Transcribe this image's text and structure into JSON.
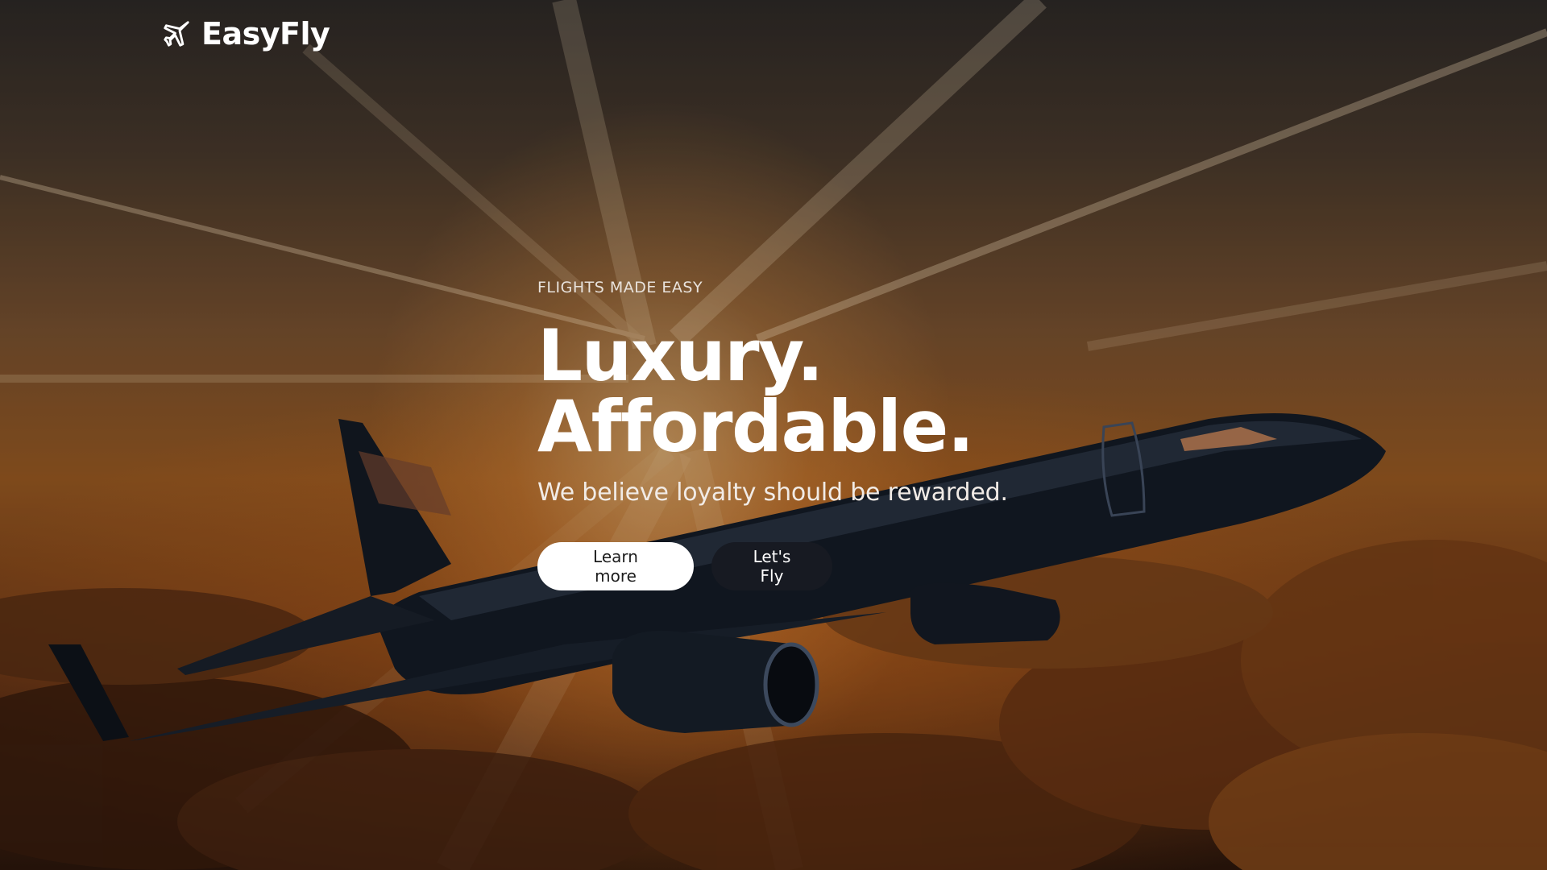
{
  "brand": {
    "name": "EasyFly",
    "logo_icon": "airplane-icon"
  },
  "hero": {
    "eyebrow": "FLIGHTS MADE EASY",
    "headline_line1": "Luxury.",
    "headline_line2": "Affordable.",
    "tagline": "We believe loyalty should be rewarded.",
    "background_image": "airplane-flying-above-clouds-at-sunset"
  },
  "actions": {
    "learn_more_label": "Learn more",
    "lets_fly_label": "Let's Fly"
  },
  "colors": {
    "text_primary": "#ffffff",
    "button_light_bg": "#ffffff",
    "button_dark_bg": "#171a22",
    "sky_orange": "#9a5a22"
  }
}
